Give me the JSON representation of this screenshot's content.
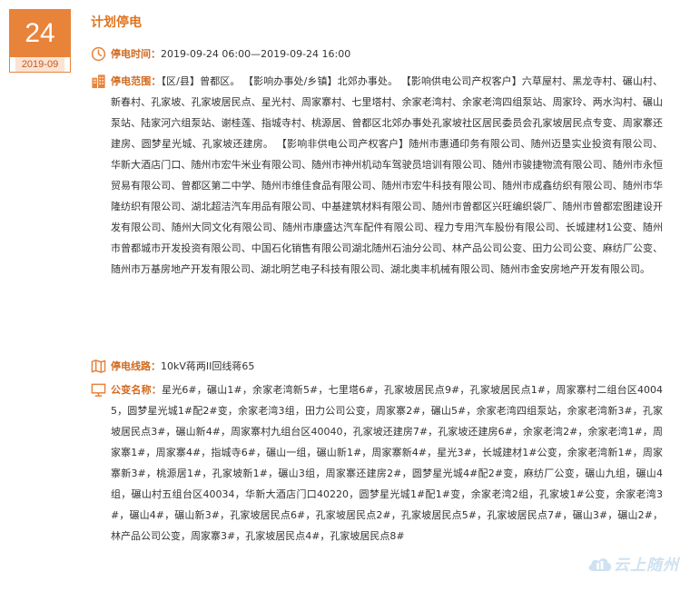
{
  "date": {
    "day": "24",
    "month": "2019-09"
  },
  "notice": {
    "title": "计划停电",
    "time_label": "停电时间：",
    "time_value": "2019-09-24 06:00—2019-09-24 16:00",
    "scope_label": "停电范围：",
    "scope_value": "【区/县】曾都区。 【影响办事处/乡镇】北郊办事处。 【影响供电公司产权客户】六草屋村、黑龙寺村、碾山村、新春村、孔家坡、孔家坡居民点、星光村、周家寨村、七里塔村、余家老湾村、余家老湾四组泵站、周家玲、两水沟村、碾山泵站、陆家河六组泵站、谢桂莲、指城寺村、桃源居、曾都区北郊办事处孔家坡社区居民委员会孔家坡居民点专变、周家寨还建房、圆梦星光城、孔家坡还建房。 【影响非供电公司产权客户】随州市惠通印务有限公司、随州迈垦实业投资有限公司、华新大酒店门口、随州市宏牛米业有限公司、随州市神州机动车驾驶员培训有限公司、随州市骏捷物流有限公司、随州市永恒贸易有限公司、曾都区第二中学、随州市维佳食品有限公司、随州市宏牛科技有限公司、随州市成鑫纺织有限公司、随州市华隆纺织有限公司、湖北超洁汽车用品有限公司、中基建筑材料有限公司、随州市曾都区兴旺编织袋厂、随州市曾都宏图建设开发有限公司、随州大同文化有限公司、随州市康盛达汽车配件有限公司、程力专用汽车股份有限公司、长城建材1公变、随州市曾都城市开发投资有限公司、中国石化销售有限公司湖北随州石油分公司、林产品公司公变、田力公司公变、麻纺厂公变、随州市万基房地产开发有限公司、湖北明艺电子科技有限公司、湖北奥丰机械有限公司、随州市金安房地产开发有限公司。",
    "line_label": "停电线路：",
    "line_value": "10kV蒋两II回线蒋65",
    "transformer_label": "公变名称：",
    "transformer_value": "星光6#，碾山1#，余家老湾新5#，七里塔6#，孔家坡居民点9#，孔家坡居民点1#，周家寨村二组台区40045，圆梦星光城1#配2#变，余家老湾3组，田力公司公变，周家寨2#，碾山5#，余家老湾四组泵站，余家老湾新3#，孔家坡居民点3#，碾山新4#，周家寨村九组台区40040，孔家坡还建房7#，孔家坡还建房6#，余家老湾2#，余家老湾1#，周家寨1#，周家寨4#，指城寺6#，碾山一组，碾山新1#，周家寨新4#，星光3#，长城建材1#公变，余家老湾新1#，周家寨新3#，桃源居1#，孔家坡新1#，碾山3组，周家寨还建房2#，圆梦星光城4#配2#变，麻纺厂公变，碾山九组，碾山4组，碾山村五组台区40034，华新大酒店门口40220，圆梦星光城1#配1#变，余家老湾2组，孔家坡1#公变，余家老湾3#，碾山4#，碾山新3#，孔家坡居民点6#，孔家坡居民点2#，孔家坡居民点5#，孔家坡居民点7#，碾山3#，碾山2#，林产品公司公变，周家寨3#，孔家坡居民点4#，孔家坡居民点8#"
  },
  "watermark": {
    "text": "云上随州"
  },
  "icons": {
    "time": "clock-icon",
    "scope": "buildings-icon",
    "line": "map-icon",
    "transformer": "monitor-icon",
    "watermark": "cloud-building-icon"
  },
  "colors": {
    "accent": "#e8833a",
    "label": "#d06a1e",
    "text": "#333333"
  }
}
